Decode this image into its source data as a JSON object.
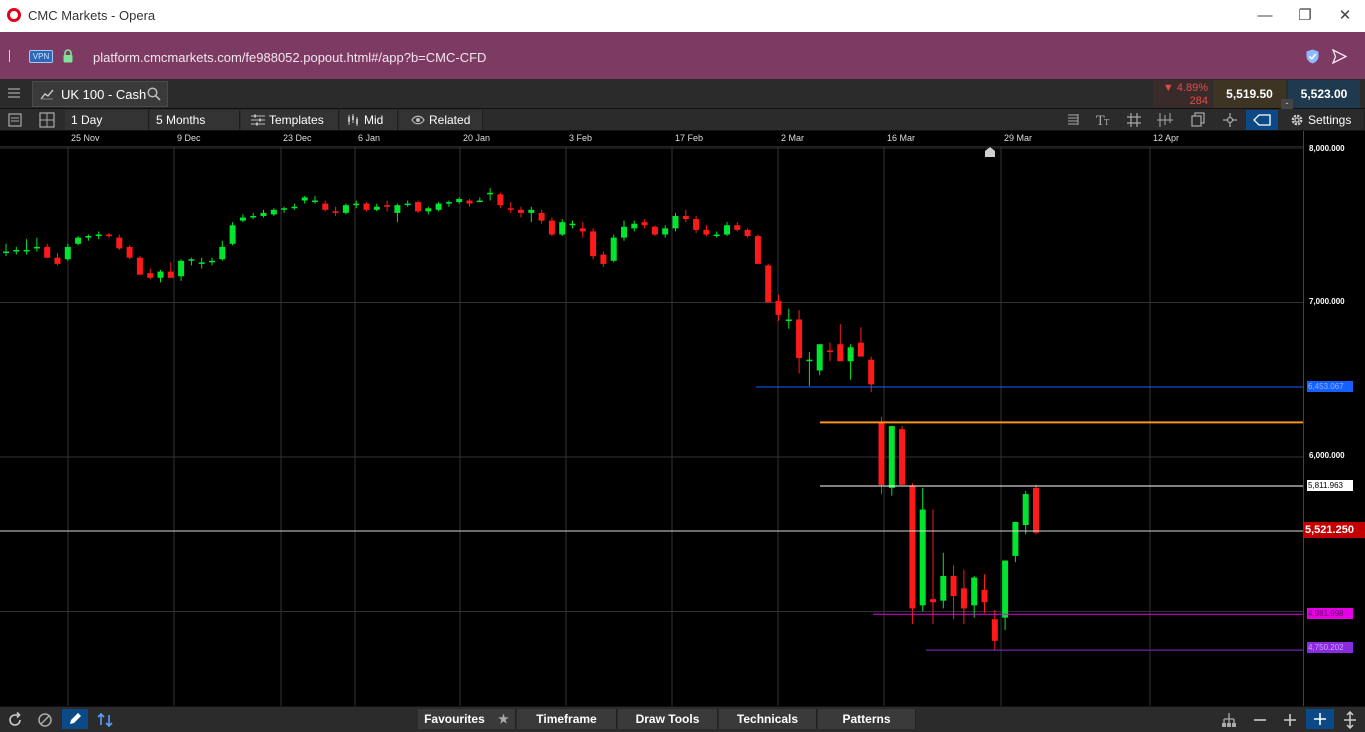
{
  "window": {
    "title": "CMC Markets - Opera"
  },
  "browser": {
    "vpn_label": "VPN",
    "url": "platform.cmcmarkets.com/fe988052.popout.html#/app?b=CMC-CFD"
  },
  "instrument": {
    "name": "UK 100 - Cash"
  },
  "quote": {
    "change_pct": "▼ 4.89%",
    "change_pts": "284",
    "sell": "5,519.50",
    "buy": "5,523.00",
    "spread": "-"
  },
  "toolbar": {
    "period": "1 Day",
    "range": "5 Months",
    "templates": "Templates",
    "price_type": "Mid",
    "related": "Related",
    "settings": "Settings"
  },
  "bottom_tabs": {
    "favourites": "Favourites",
    "timeframe": "Timeframe",
    "draw_tools": "Draw Tools",
    "technicals": "Technicals",
    "patterns": "Patterns"
  },
  "colors": {
    "up": "#00e62e",
    "down": "#ff1a1a",
    "current": "#c30000",
    "orange": "#f7941d",
    "blue": "#1560ff",
    "magenta": "#e600e6",
    "purple": "#8a2be2"
  },
  "chart_data": {
    "type": "candlestick",
    "x_labels": [
      "25 Nov",
      "9 Dec",
      "23 Dec",
      "6 Jan",
      "20 Jan",
      "3 Feb",
      "17 Feb",
      "2 Mar",
      "16 Mar",
      "29 Mar",
      "12 Apr"
    ],
    "y_ticks": [
      "8,000.000",
      "7,000.000",
      "6,000.000"
    ],
    "ylim": [
      4200,
      8000
    ],
    "current_price": "5,521.250",
    "levels": [
      {
        "label": "6,453.067",
        "value": 6453.067,
        "color": "#1560ff"
      },
      {
        "label": "5,811.963",
        "value": 5811.963,
        "color": "#ffffff"
      },
      {
        "label": "4,981.998",
        "value": 4981.998,
        "color": "#e600e6"
      },
      {
        "label": "4,750.202",
        "value": 4750.202,
        "color": "#8a2be2"
      }
    ],
    "horizontal_lines": [
      {
        "value": 6224,
        "color": "#f7941d"
      }
    ],
    "ohlc": [
      [
        7330,
        7380,
        7300,
        7330
      ],
      [
        7330,
        7360,
        7310,
        7340
      ],
      [
        7340,
        7410,
        7310,
        7340
      ],
      [
        7350,
        7420,
        7330,
        7360
      ],
      [
        7360,
        7380,
        7290,
        7290
      ],
      [
        7290,
        7320,
        7240,
        7250
      ],
      [
        7280,
        7380,
        7270,
        7360
      ],
      [
        7380,
        7430,
        7370,
        7420
      ],
      [
        7420,
        7440,
        7400,
        7430
      ],
      [
        7430,
        7460,
        7410,
        7440
      ],
      [
        7440,
        7450,
        7420,
        7430
      ],
      [
        7420,
        7440,
        7340,
        7350
      ],
      [
        7360,
        7370,
        7280,
        7290
      ],
      [
        7290,
        7300,
        7180,
        7180
      ],
      [
        7190,
        7220,
        7150,
        7160
      ],
      [
        7160,
        7210,
        7130,
        7200
      ],
      [
        7200,
        7260,
        7160,
        7160
      ],
      [
        7170,
        7280,
        7140,
        7270
      ],
      [
        7270,
        7290,
        7240,
        7280
      ],
      [
        7250,
        7290,
        7220,
        7260
      ],
      [
        7260,
        7290,
        7240,
        7270
      ],
      [
        7280,
        7400,
        7270,
        7360
      ],
      [
        7380,
        7520,
        7370,
        7500
      ],
      [
        7530,
        7570,
        7520,
        7550
      ],
      [
        7550,
        7580,
        7540,
        7560
      ],
      [
        7560,
        7600,
        7550,
        7580
      ],
      [
        7570,
        7610,
        7560,
        7600
      ],
      [
        7610,
        7620,
        7580,
        7610
      ],
      [
        7620,
        7640,
        7600,
        7620
      ],
      [
        7660,
        7690,
        7640,
        7680
      ],
      [
        7660,
        7690,
        7640,
        7660
      ],
      [
        7640,
        7660,
        7590,
        7600
      ],
      [
        7590,
        7620,
        7560,
        7580
      ],
      [
        7580,
        7640,
        7570,
        7630
      ],
      [
        7630,
        7660,
        7610,
        7640
      ],
      [
        7640,
        7650,
        7590,
        7600
      ],
      [
        7600,
        7640,
        7590,
        7620
      ],
      [
        7630,
        7660,
        7590,
        7620
      ],
      [
        7580,
        7640,
        7520,
        7630
      ],
      [
        7640,
        7660,
        7620,
        7640
      ],
      [
        7650,
        7660,
        7580,
        7590
      ],
      [
        7590,
        7620,
        7570,
        7610
      ],
      [
        7600,
        7650,
        7590,
        7640
      ],
      [
        7650,
        7660,
        7620,
        7650
      ],
      [
        7650,
        7680,
        7640,
        7670
      ],
      [
        7660,
        7670,
        7620,
        7640
      ],
      [
        7660,
        7680,
        7650,
        7660
      ],
      [
        7700,
        7740,
        7660,
        7710
      ],
      [
        7700,
        7710,
        7610,
        7630
      ],
      [
        7610,
        7650,
        7580,
        7600
      ],
      [
        7600,
        7620,
        7550,
        7580
      ],
      [
        7580,
        7620,
        7520,
        7600
      ],
      [
        7580,
        7600,
        7510,
        7530
      ],
      [
        7530,
        7550,
        7430,
        7440
      ],
      [
        7440,
        7540,
        7430,
        7520
      ],
      [
        7510,
        7530,
        7480,
        7510
      ],
      [
        7480,
        7520,
        7420,
        7460
      ],
      [
        7460,
        7480,
        7280,
        7300
      ],
      [
        7310,
        7330,
        7230,
        7250
      ],
      [
        7270,
        7440,
        7260,
        7420
      ],
      [
        7420,
        7530,
        7400,
        7490
      ],
      [
        7480,
        7530,
        7460,
        7510
      ],
      [
        7520,
        7540,
        7480,
        7500
      ],
      [
        7490,
        7500,
        7430,
        7440
      ],
      [
        7440,
        7500,
        7420,
        7480
      ],
      [
        7480,
        7580,
        7460,
        7560
      ],
      [
        7560,
        7600,
        7520,
        7540
      ],
      [
        7540,
        7560,
        7450,
        7470
      ],
      [
        7470,
        7500,
        7430,
        7440
      ],
      [
        7430,
        7460,
        7420,
        7440
      ],
      [
        7440,
        7520,
        7430,
        7500
      ],
      [
        7500,
        7520,
        7460,
        7470
      ],
      [
        7470,
        7480,
        7420,
        7430
      ],
      [
        7430,
        7440,
        7290,
        7250
      ],
      [
        7240,
        7250,
        7000,
        7000
      ],
      [
        7010,
        7050,
        6880,
        6920
      ],
      [
        6880,
        6960,
        6830,
        6890
      ],
      [
        6890,
        6950,
        6540,
        6640
      ],
      [
        6620,
        6680,
        6460,
        6630
      ],
      [
        6560,
        6730,
        6530,
        6730
      ],
      [
        6690,
        6740,
        6620,
        6680
      ],
      [
        6730,
        6860,
        6640,
        6620
      ],
      [
        6620,
        6730,
        6500,
        6710
      ],
      [
        6740,
        6840,
        6690,
        6650
      ],
      [
        6630,
        6650,
        6420,
        6470
      ],
      [
        6220,
        6260,
        5760,
        5820
      ],
      [
        5800,
        6190,
        5750,
        6200
      ],
      [
        6180,
        6200,
        5900,
        5820
      ],
      [
        5810,
        5830,
        4920,
        5020
      ],
      [
        5040,
        5800,
        5000,
        5660
      ],
      [
        5080,
        5660,
        4920,
        5060
      ],
      [
        5070,
        5380,
        5020,
        5230
      ],
      [
        5230,
        5300,
        4950,
        5100
      ],
      [
        5150,
        5270,
        4920,
        5020
      ],
      [
        5040,
        5230,
        4960,
        5220
      ],
      [
        5140,
        5240,
        4990,
        5060
      ],
      [
        4950,
        5010,
        4750,
        4810
      ],
      [
        4960,
        5330,
        4880,
        5330
      ],
      [
        5360,
        5500,
        5320,
        5580
      ],
      [
        5560,
        5780,
        5500,
        5760
      ],
      [
        5800,
        5820,
        5500,
        5510
      ]
    ]
  }
}
